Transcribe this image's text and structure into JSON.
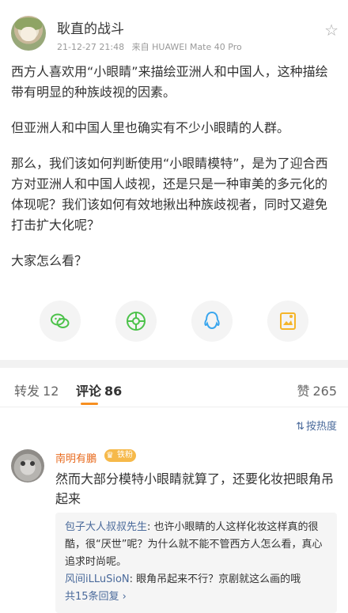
{
  "post": {
    "username": "耿直的战斗",
    "time": "21-12-27 21:48",
    "source": "来自 HUAWEI Mate 40 Pro",
    "paragraphs": [
      "西方人喜欢用“小眼睛”来描绘亚洲人和中国人，这种描绘带有明显的种族歧视的因素。",
      "但亚洲人和中国人里也确实有不少小眼睛的人群。",
      "那么，我们该如何判断使用“小眼睛模特”，是为了迎合西方对亚洲人和中国人歧视，还是只是一种审美的多元化的体现呢？我们该如何有效地揪出种族歧视者，同时又避免打击扩大化呢？",
      "大家怎么看？"
    ]
  },
  "share": {
    "icons": [
      "wechat-icon",
      "moments-icon",
      "qq-icon",
      "qzone-icon"
    ],
    "colors": {
      "wechat": "#4cc24a",
      "moments": "#4cc24a",
      "qq": "#3aa6ee",
      "qzone": "#f5b52a"
    }
  },
  "tabs": {
    "repost_label": "转发",
    "repost_count": "12",
    "comment_label": "评论",
    "comment_count": "86",
    "like_label": "赞",
    "like_count": "265"
  },
  "sort": {
    "label": "按热度"
  },
  "comment": {
    "username": "南明有鵬",
    "badge": "铁粉",
    "text": "然而大部分模特小眼睛就算了，还要化妆把眼角吊起来",
    "replies": [
      {
        "name": "包子大人叔叔先生",
        "text": "也许小眼睛的人这样化妆这样真的很酷，很“厌世”呢？为什么就不能不管西方人怎么看，真心追求时尚呢。"
      },
      {
        "name": "风间iLLuSioN",
        "text": "眼角吊起来不行？京剧就这么画的哦"
      }
    ],
    "more_label": "共15条回复 ›"
  },
  "colors": {
    "accent": "#f78f21",
    "link": "#4a6a9b",
    "name_orange": "#e86b1f"
  }
}
